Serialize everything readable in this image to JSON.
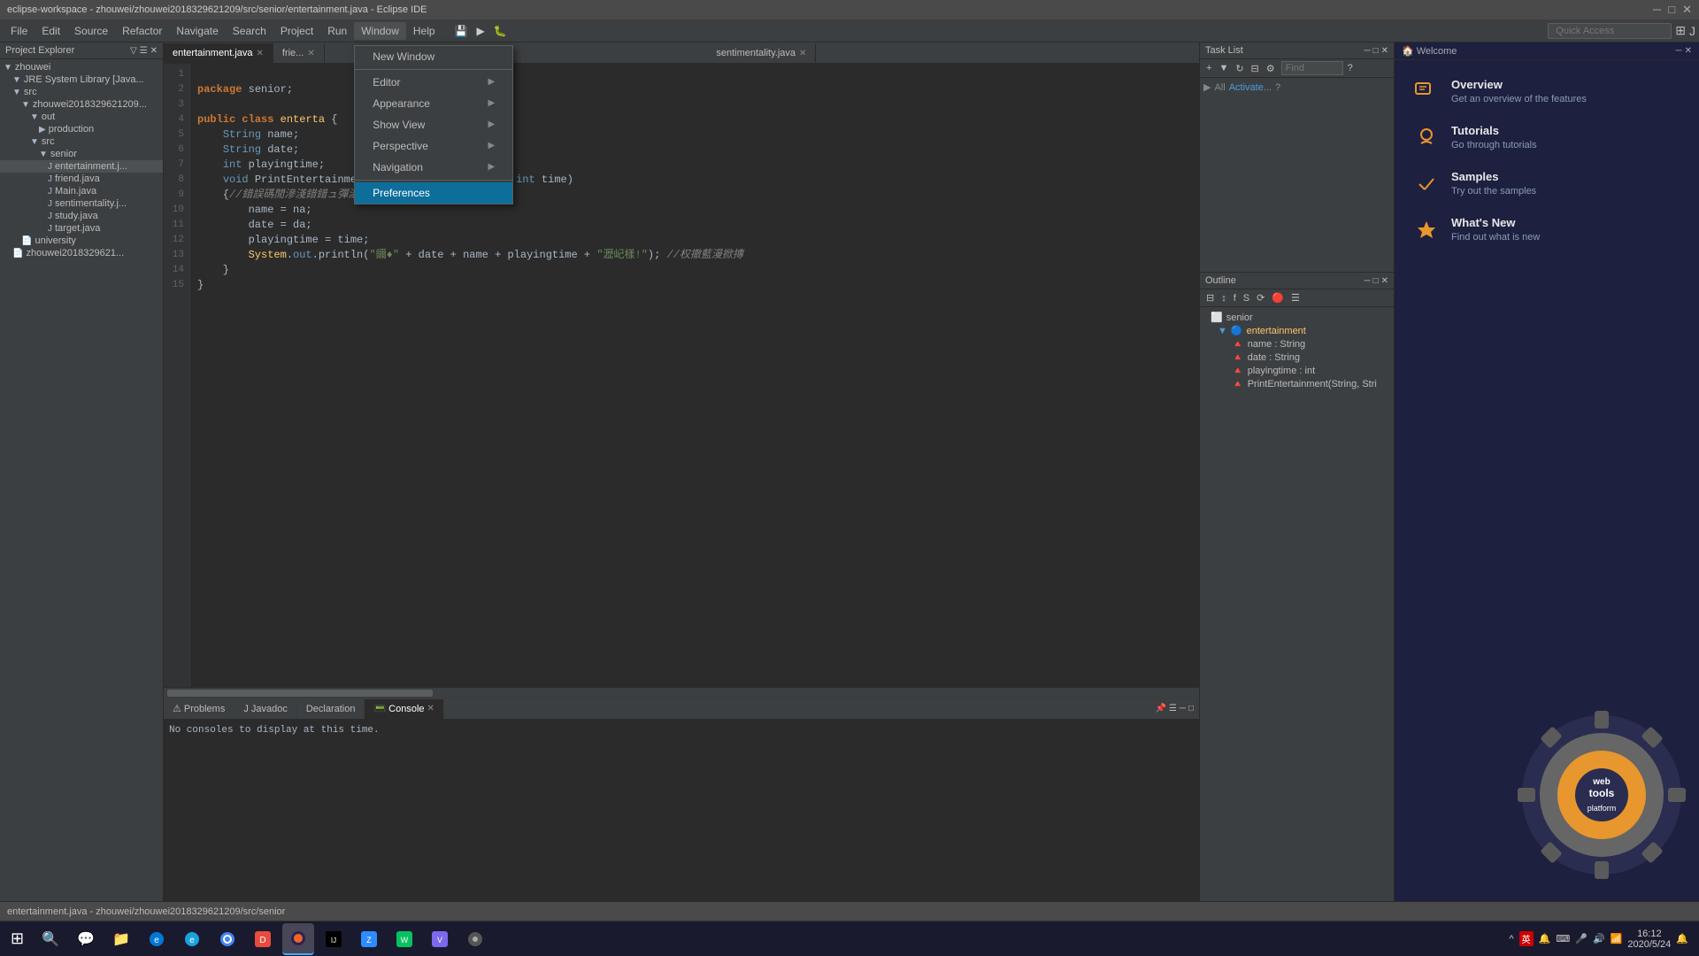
{
  "title_bar": {
    "text": "eclipse-workspace - zhouwei/zhouwei2018329621209/src/senior/entertainment.java - Eclipse IDE",
    "minimize": "─",
    "maximize": "□",
    "close": "✕"
  },
  "menu": {
    "items": [
      "File",
      "Edit",
      "Source",
      "Refactor",
      "Navigate",
      "Search",
      "Project",
      "Run",
      "Window",
      "Help"
    ]
  },
  "toolbar": {
    "quick_access_placeholder": "Quick Access"
  },
  "window_dropdown": {
    "items": [
      {
        "label": "New Window",
        "arrow": ""
      },
      {
        "label": "Editor",
        "arrow": "▶"
      },
      {
        "label": "Appearance",
        "arrow": "▶"
      },
      {
        "label": "Show View",
        "arrow": "▶"
      },
      {
        "label": "Perspective",
        "arrow": "▶"
      },
      {
        "label": "Navigation",
        "arrow": "▶"
      },
      {
        "label": "Preferences",
        "arrow": "",
        "highlighted": true
      }
    ]
  },
  "project_explorer": {
    "title": "Project Explorer",
    "tree": [
      {
        "indent": 0,
        "icon": "▼",
        "label": "zhouwei",
        "type": "folder"
      },
      {
        "indent": 1,
        "icon": "▼",
        "label": "JRE System Library [Java...",
        "type": "lib"
      },
      {
        "indent": 1,
        "icon": "▼",
        "label": "src",
        "type": "folder"
      },
      {
        "indent": 2,
        "icon": "▼",
        "label": "zhouwei2018329621209...",
        "type": "folder"
      },
      {
        "indent": 3,
        "icon": "▼",
        "label": "out",
        "type": "folder"
      },
      {
        "indent": 4,
        "icon": "▼",
        "label": "production",
        "type": "folder"
      },
      {
        "indent": 3,
        "icon": "▼",
        "label": "src",
        "type": "folder"
      },
      {
        "indent": 4,
        "icon": "▼",
        "label": "senior",
        "type": "package"
      },
      {
        "indent": 5,
        "icon": "📄",
        "label": "entertainment.j...",
        "type": "java",
        "active": true
      },
      {
        "indent": 5,
        "icon": "📄",
        "label": "friend.java",
        "type": "java"
      },
      {
        "indent": 5,
        "icon": "📄",
        "label": "Main.java",
        "type": "java"
      },
      {
        "indent": 5,
        "icon": "📄",
        "label": "sentimentality.j...",
        "type": "java"
      },
      {
        "indent": 5,
        "icon": "📄",
        "label": "study.java",
        "type": "java"
      },
      {
        "indent": 5,
        "icon": "📄",
        "label": "target.java",
        "type": "java"
      },
      {
        "indent": 2,
        "icon": "📄",
        "label": "university",
        "type": "java"
      },
      {
        "indent": 1,
        "icon": "📄",
        "label": "zhouwei2018329621...",
        "type": "file"
      }
    ]
  },
  "editor": {
    "tabs": [
      {
        "label": "entertainment.java",
        "active": true
      },
      {
        "label": "frie...",
        "active": false
      }
    ],
    "inactive_tab": "sentimentality.java",
    "lines": [
      {
        "num": 1,
        "content": "package senior;",
        "highlight": false
      },
      {
        "num": 2,
        "content": "",
        "highlight": false
      },
      {
        "num": 3,
        "content": "public class enterta",
        "highlight": false
      },
      {
        "num": 4,
        "content": "    String name;",
        "highlight": false
      },
      {
        "num": 5,
        "content": "    String date;",
        "highlight": false
      },
      {
        "num": 6,
        "content": "    int playingtime;",
        "highlight": false
      },
      {
        "num": 7,
        "content": "    void PrintEntertainment(String na, String da, int time)",
        "highlight": false
      },
      {
        "num": 8,
        "content": "    {//錯誤碼閒滲淺錯錯ュ彈瀑飲熔鐵♦y㑇僅佰",
        "highlight": false
      },
      {
        "num": 9,
        "content": "        name = na;",
        "highlight": false
      },
      {
        "num": 10,
        "content": "        date = da;",
        "highlight": false
      },
      {
        "num": 11,
        "content": "        playingtime = time;",
        "highlight": false
      },
      {
        "num": 12,
        "content": "        System.out.println(\"鑈♦\" + date + name + playingtime + \"瀝屺樣!\"); //权撤藍漫掀摶",
        "highlight": false
      },
      {
        "num": 13,
        "content": "    }",
        "highlight": false
      },
      {
        "num": 14,
        "content": "}",
        "highlight": false
      },
      {
        "num": 15,
        "content": "",
        "highlight": false
      }
    ]
  },
  "task_list": {
    "title": "Task List",
    "find_placeholder": "Find",
    "activate_label": "Activate..."
  },
  "outline": {
    "title": "Outline",
    "items": [
      {
        "indent": 0,
        "icon": "⬜",
        "label": "senior",
        "type": "package"
      },
      {
        "indent": 1,
        "icon": "🔵",
        "label": "entertainment",
        "type": "class",
        "expanded": true
      },
      {
        "indent": 2,
        "icon": "🔺",
        "label": "name : String",
        "type": "field"
      },
      {
        "indent": 2,
        "icon": "🔺",
        "label": "date : String",
        "type": "field"
      },
      {
        "indent": 2,
        "icon": "🔺",
        "label": "playingtime : int",
        "type": "field"
      },
      {
        "indent": 2,
        "icon": "🔺",
        "label": "PrintEntertainment(String, Stri",
        "type": "method"
      }
    ]
  },
  "welcome": {
    "title": "Welcome",
    "items": [
      {
        "icon": "📖",
        "title": "Overview",
        "desc": "Get an overview of the features"
      },
      {
        "icon": "🎓",
        "title": "Tutorials",
        "desc": "Go through tutorials"
      },
      {
        "icon": "✏️",
        "title": "Samples",
        "desc": "Try out the samples"
      },
      {
        "icon": "⭐",
        "title": "What's New",
        "desc": "Find out what is new"
      }
    ]
  },
  "bottom_panel": {
    "tabs": [
      "Problems",
      "Javadoc",
      "Declaration",
      "Console"
    ],
    "active_tab": "Console",
    "console_text": "No consoles to display at this time."
  },
  "status_bar": {
    "text": "entertainment.java - zhouwei/zhouwei2018329621209/src/senior"
  },
  "taskbar": {
    "icons": [
      "⊞",
      "🔍",
      "💬",
      "📋",
      "📁",
      "🌐",
      "🔔",
      "🔵",
      "🎮",
      "🦊",
      "☕",
      "📊",
      "📹",
      "💬",
      "🟢"
    ],
    "clock": "16:12\n2020/5/24",
    "tray_icons": [
      "英",
      "🔔",
      "⌨",
      "🎤",
      "🔊"
    ]
  }
}
